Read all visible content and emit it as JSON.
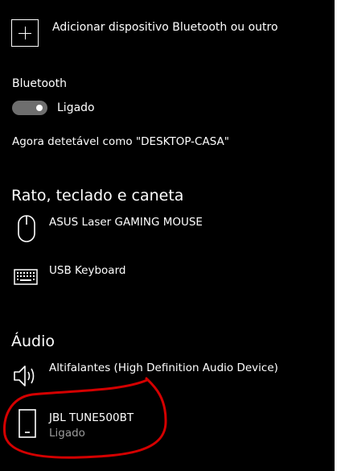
{
  "add_device": {
    "label": "Adicionar dispositivo Bluetooth ou outro"
  },
  "bluetooth": {
    "title": "Bluetooth",
    "toggle_state": "on",
    "toggle_label": "Ligado",
    "discoverable_text": "Agora detetável como \"DESKTOP-CASA\""
  },
  "sections": {
    "mouse_keyboard_pen": {
      "title": "Rato, teclado e caneta",
      "devices": [
        {
          "name": "ASUS Laser GAMING MOUSE",
          "icon": "mouse-icon"
        },
        {
          "name": "USB Keyboard",
          "icon": "keyboard-icon"
        }
      ]
    },
    "audio": {
      "title": "Áudio",
      "devices": [
        {
          "name": "Altifalantes (High Definition Audio Device)",
          "icon": "speaker-icon"
        },
        {
          "name": "JBL TUNE500BT",
          "status": "Ligado",
          "icon": "phone-device-icon"
        }
      ]
    }
  },
  "colors": {
    "background": "#000000",
    "text": "#ffffff",
    "secondary_text": "#9b9b9b",
    "toggle_track": "#6e6e6e",
    "annotation": "#d40000"
  }
}
